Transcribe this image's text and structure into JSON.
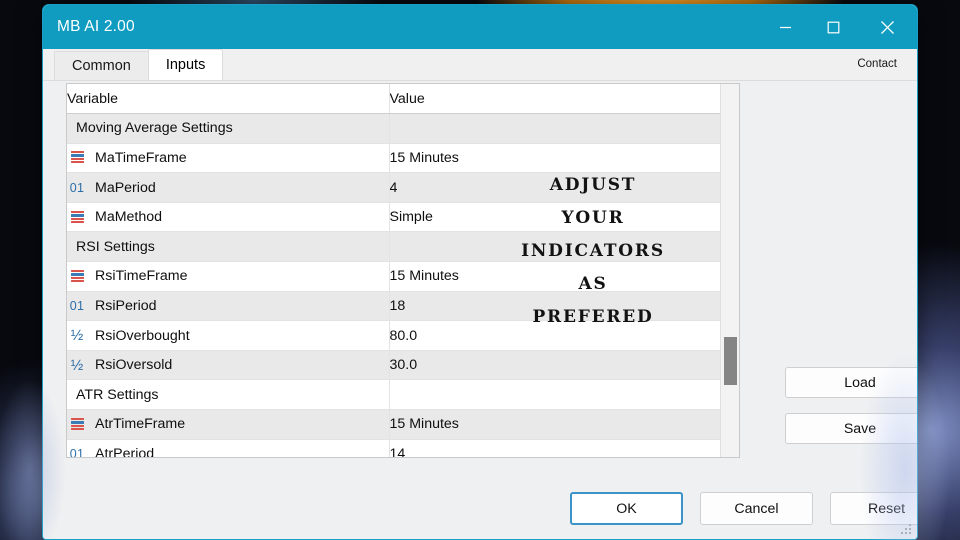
{
  "window": {
    "title": "MB AI 2.00",
    "controls": {
      "minimize": "minimize-icon",
      "maximize": "maximize-icon",
      "close": "close-icon"
    },
    "accent_color": "#0f9cc0"
  },
  "tabs": [
    {
      "label": "Common",
      "active": false
    },
    {
      "label": "Inputs",
      "active": true
    }
  ],
  "contact_link": "Contact",
  "table": {
    "columns": [
      "Variable",
      "Value"
    ],
    "rows": [
      {
        "icon": "none",
        "variable": "Moving Average Settings",
        "value": ""
      },
      {
        "icon": "timeframe",
        "variable": "MaTimeFrame",
        "value": "15 Minutes"
      },
      {
        "icon": "integer",
        "variable": "MaPeriod",
        "value": "4"
      },
      {
        "icon": "timeframe",
        "variable": "MaMethod",
        "value": "Simple"
      },
      {
        "icon": "none",
        "variable": "RSI Settings",
        "value": ""
      },
      {
        "icon": "timeframe",
        "variable": "RsiTimeFrame",
        "value": "15 Minutes"
      },
      {
        "icon": "integer",
        "variable": "RsiPeriod",
        "value": "18"
      },
      {
        "icon": "fraction",
        "variable": "RsiOverbought",
        "value": "80.0"
      },
      {
        "icon": "fraction",
        "variable": "RsiOversold",
        "value": "30.0"
      },
      {
        "icon": "none",
        "variable": "ATR Settings",
        "value": ""
      },
      {
        "icon": "timeframe",
        "variable": "AtrTimeFrame",
        "value": "15 Minutes"
      },
      {
        "icon": "integer",
        "variable": "AtrPeriod",
        "value": "14"
      }
    ],
    "icon_glyphs": {
      "integer": "01",
      "fraction": "½"
    }
  },
  "overlay_caption": [
    "ADJUST",
    "YOUR",
    "INDICATORS",
    "AS",
    "PREFERED"
  ],
  "side_buttons": [
    {
      "label": "Load"
    },
    {
      "label": "Save"
    }
  ],
  "bottom_buttons": [
    {
      "label": "OK",
      "focused": true
    },
    {
      "label": "Cancel",
      "focused": false
    },
    {
      "label": "Reset",
      "focused": false
    }
  ]
}
